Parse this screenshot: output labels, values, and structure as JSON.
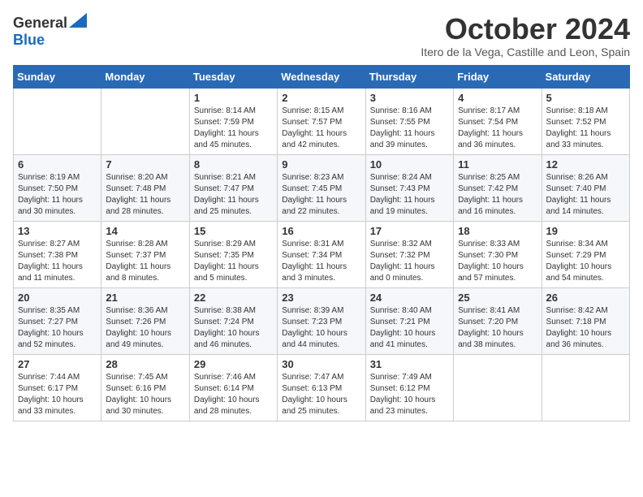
{
  "header": {
    "logo_general": "General",
    "logo_blue": "Blue",
    "month_title": "October 2024",
    "subtitle": "Itero de la Vega, Castille and Leon, Spain"
  },
  "weekdays": [
    "Sunday",
    "Monday",
    "Tuesday",
    "Wednesday",
    "Thursday",
    "Friday",
    "Saturday"
  ],
  "weeks": [
    [
      {
        "day": "",
        "info": ""
      },
      {
        "day": "",
        "info": ""
      },
      {
        "day": "1",
        "info": "Sunrise: 8:14 AM\nSunset: 7:59 PM\nDaylight: 11 hours and 45 minutes."
      },
      {
        "day": "2",
        "info": "Sunrise: 8:15 AM\nSunset: 7:57 PM\nDaylight: 11 hours and 42 minutes."
      },
      {
        "day": "3",
        "info": "Sunrise: 8:16 AM\nSunset: 7:55 PM\nDaylight: 11 hours and 39 minutes."
      },
      {
        "day": "4",
        "info": "Sunrise: 8:17 AM\nSunset: 7:54 PM\nDaylight: 11 hours and 36 minutes."
      },
      {
        "day": "5",
        "info": "Sunrise: 8:18 AM\nSunset: 7:52 PM\nDaylight: 11 hours and 33 minutes."
      }
    ],
    [
      {
        "day": "6",
        "info": "Sunrise: 8:19 AM\nSunset: 7:50 PM\nDaylight: 11 hours and 30 minutes."
      },
      {
        "day": "7",
        "info": "Sunrise: 8:20 AM\nSunset: 7:48 PM\nDaylight: 11 hours and 28 minutes."
      },
      {
        "day": "8",
        "info": "Sunrise: 8:21 AM\nSunset: 7:47 PM\nDaylight: 11 hours and 25 minutes."
      },
      {
        "day": "9",
        "info": "Sunrise: 8:23 AM\nSunset: 7:45 PM\nDaylight: 11 hours and 22 minutes."
      },
      {
        "day": "10",
        "info": "Sunrise: 8:24 AM\nSunset: 7:43 PM\nDaylight: 11 hours and 19 minutes."
      },
      {
        "day": "11",
        "info": "Sunrise: 8:25 AM\nSunset: 7:42 PM\nDaylight: 11 hours and 16 minutes."
      },
      {
        "day": "12",
        "info": "Sunrise: 8:26 AM\nSunset: 7:40 PM\nDaylight: 11 hours and 14 minutes."
      }
    ],
    [
      {
        "day": "13",
        "info": "Sunrise: 8:27 AM\nSunset: 7:38 PM\nDaylight: 11 hours and 11 minutes."
      },
      {
        "day": "14",
        "info": "Sunrise: 8:28 AM\nSunset: 7:37 PM\nDaylight: 11 hours and 8 minutes."
      },
      {
        "day": "15",
        "info": "Sunrise: 8:29 AM\nSunset: 7:35 PM\nDaylight: 11 hours and 5 minutes."
      },
      {
        "day": "16",
        "info": "Sunrise: 8:31 AM\nSunset: 7:34 PM\nDaylight: 11 hours and 3 minutes."
      },
      {
        "day": "17",
        "info": "Sunrise: 8:32 AM\nSunset: 7:32 PM\nDaylight: 11 hours and 0 minutes."
      },
      {
        "day": "18",
        "info": "Sunrise: 8:33 AM\nSunset: 7:30 PM\nDaylight: 10 hours and 57 minutes."
      },
      {
        "day": "19",
        "info": "Sunrise: 8:34 AM\nSunset: 7:29 PM\nDaylight: 10 hours and 54 minutes."
      }
    ],
    [
      {
        "day": "20",
        "info": "Sunrise: 8:35 AM\nSunset: 7:27 PM\nDaylight: 10 hours and 52 minutes."
      },
      {
        "day": "21",
        "info": "Sunrise: 8:36 AM\nSunset: 7:26 PM\nDaylight: 10 hours and 49 minutes."
      },
      {
        "day": "22",
        "info": "Sunrise: 8:38 AM\nSunset: 7:24 PM\nDaylight: 10 hours and 46 minutes."
      },
      {
        "day": "23",
        "info": "Sunrise: 8:39 AM\nSunset: 7:23 PM\nDaylight: 10 hours and 44 minutes."
      },
      {
        "day": "24",
        "info": "Sunrise: 8:40 AM\nSunset: 7:21 PM\nDaylight: 10 hours and 41 minutes."
      },
      {
        "day": "25",
        "info": "Sunrise: 8:41 AM\nSunset: 7:20 PM\nDaylight: 10 hours and 38 minutes."
      },
      {
        "day": "26",
        "info": "Sunrise: 8:42 AM\nSunset: 7:18 PM\nDaylight: 10 hours and 36 minutes."
      }
    ],
    [
      {
        "day": "27",
        "info": "Sunrise: 7:44 AM\nSunset: 6:17 PM\nDaylight: 10 hours and 33 minutes."
      },
      {
        "day": "28",
        "info": "Sunrise: 7:45 AM\nSunset: 6:16 PM\nDaylight: 10 hours and 30 minutes."
      },
      {
        "day": "29",
        "info": "Sunrise: 7:46 AM\nSunset: 6:14 PM\nDaylight: 10 hours and 28 minutes."
      },
      {
        "day": "30",
        "info": "Sunrise: 7:47 AM\nSunset: 6:13 PM\nDaylight: 10 hours and 25 minutes."
      },
      {
        "day": "31",
        "info": "Sunrise: 7:49 AM\nSunset: 6:12 PM\nDaylight: 10 hours and 23 minutes."
      },
      {
        "day": "",
        "info": ""
      },
      {
        "day": "",
        "info": ""
      }
    ]
  ]
}
